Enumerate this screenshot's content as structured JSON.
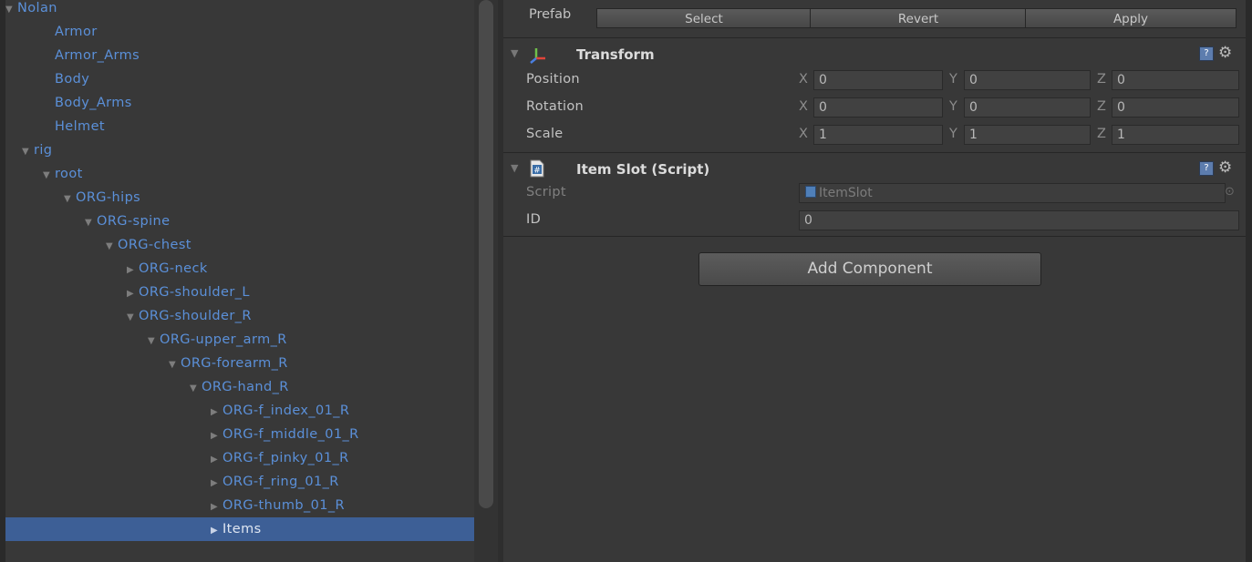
{
  "hierarchy": {
    "items": [
      {
        "label": "Nolan",
        "arrow": "▼",
        "depth": 0
      },
      {
        "label": "Armor",
        "arrow": "",
        "depth": 2
      },
      {
        "label": "Armor_Arms",
        "arrow": "",
        "depth": 2
      },
      {
        "label": "Body",
        "arrow": "",
        "depth": 2
      },
      {
        "label": "Body_Arms",
        "arrow": "",
        "depth": 2
      },
      {
        "label": "Helmet",
        "arrow": "",
        "depth": 2
      },
      {
        "label": "rig",
        "arrow": "▼",
        "depth": 1
      },
      {
        "label": "root",
        "arrow": "▼",
        "depth": 2
      },
      {
        "label": "ORG-hips",
        "arrow": "▼",
        "depth": 3
      },
      {
        "label": "ORG-spine",
        "arrow": "▼",
        "depth": 4
      },
      {
        "label": "ORG-chest",
        "arrow": "▼",
        "depth": 5
      },
      {
        "label": "ORG-neck",
        "arrow": "▶",
        "depth": 6
      },
      {
        "label": "ORG-shoulder_L",
        "arrow": "▶",
        "depth": 6
      },
      {
        "label": "ORG-shoulder_R",
        "arrow": "▼",
        "depth": 6
      },
      {
        "label": "ORG-upper_arm_R",
        "arrow": "▼",
        "depth": 7
      },
      {
        "label": "ORG-forearm_R",
        "arrow": "▼",
        "depth": 8
      },
      {
        "label": "ORG-hand_R",
        "arrow": "▼",
        "depth": 9
      },
      {
        "label": "ORG-f_index_01_R",
        "arrow": "▶",
        "depth": 10
      },
      {
        "label": "ORG-f_middle_01_R",
        "arrow": "▶",
        "depth": 10
      },
      {
        "label": "ORG-f_pinky_01_R",
        "arrow": "▶",
        "depth": 10
      },
      {
        "label": "ORG-f_ring_01_R",
        "arrow": "▶",
        "depth": 10
      },
      {
        "label": "ORG-thumb_01_R",
        "arrow": "▶",
        "depth": 10
      },
      {
        "label": "Items",
        "arrow": "▶",
        "depth": 10,
        "selected": true
      }
    ]
  },
  "prefab": {
    "label": "Prefab",
    "select_label": "Select",
    "revert_label": "Revert",
    "apply_label": "Apply"
  },
  "transform": {
    "title": "Transform",
    "position": {
      "label": "Position",
      "x": "0",
      "y": "0",
      "z": "0"
    },
    "rotation": {
      "label": "Rotation",
      "x": "0",
      "y": "0",
      "z": "0"
    },
    "scale": {
      "label": "Scale",
      "x": "1",
      "y": "1",
      "z": "1"
    },
    "axis_x": "X",
    "axis_y": "Y",
    "axis_z": "Z"
  },
  "item_slot": {
    "title": "Item Slot (Script)",
    "script_label": "Script",
    "script_value": "ItemSlot",
    "id_label": "ID",
    "id_value": "0"
  },
  "add_component_label": "Add Component",
  "colors": {
    "selection": "#3d5f96",
    "tree_text": "#5b90d9",
    "panel": "#383838"
  }
}
